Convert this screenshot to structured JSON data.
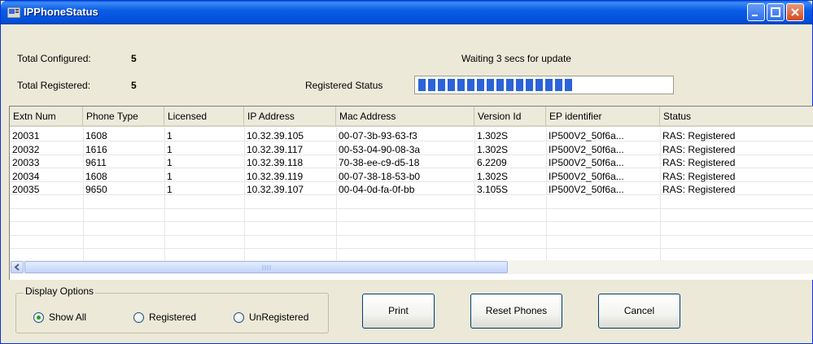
{
  "window": {
    "title": "IPPhoneStatus"
  },
  "summary": {
    "total_configured_label": "Total Configured:",
    "total_configured_value": "5",
    "total_registered_label": "Total Registered:",
    "total_registered_value": "5",
    "update_status": "Waiting 3 secs for update",
    "registered_status_label": "Registered Status",
    "registered_progress": 0.62
  },
  "table": {
    "columns": [
      "Extn Num",
      "Phone Type",
      "Licensed",
      "IP Address",
      "Mac Address",
      "Version Id",
      "EP identifier",
      "Status"
    ],
    "rows": [
      [
        "20031",
        "1608",
        "1",
        "10.32.39.105",
        "00-07-3b-93-63-f3",
        "1.302S",
        "IP500V2_50f6a...",
        "RAS: Registered"
      ],
      [
        "20032",
        "1616",
        "1",
        "10.32.39.117",
        "00-53-04-90-08-3a",
        "1.302S",
        "IP500V2_50f6a...",
        "RAS: Registered"
      ],
      [
        "20033",
        "9611",
        "1",
        "10.32.39.118",
        "70-38-ee-c9-d5-18",
        "6.2209",
        "IP500V2_50f6a...",
        "RAS: Registered"
      ],
      [
        "20034",
        "1608",
        "1",
        "10.32.39.119",
        "00-07-38-18-53-b0",
        "1.302S",
        "IP500V2_50f6a...",
        "RAS: Registered"
      ],
      [
        "20035",
        "9650",
        "1",
        "10.32.39.107",
        "00-04-0d-fa-0f-bb",
        "3.105S",
        "IP500V2_50f6a...",
        "RAS: Registered"
      ]
    ]
  },
  "display_options": {
    "title": "Display Options",
    "options": [
      "Show All",
      "Registered",
      "UnRegistered"
    ],
    "selected": "Show All"
  },
  "buttons": {
    "print": "Print",
    "reset_phones": "Reset Phones",
    "cancel": "Cancel"
  },
  "colors": {
    "titlebar": "#0a5be6",
    "progress_fill": "#2b63d8",
    "window_bg": "#ece9d8"
  }
}
